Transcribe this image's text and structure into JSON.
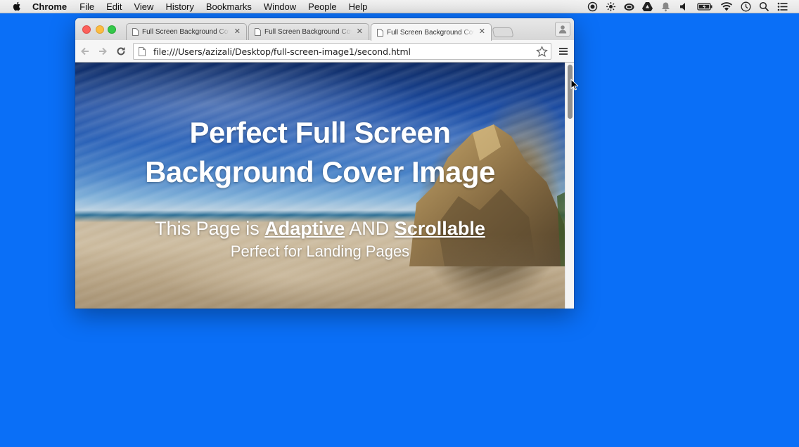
{
  "menubar": {
    "app_name": "Chrome",
    "items": [
      "File",
      "Edit",
      "View",
      "History",
      "Bookmarks",
      "Window",
      "People",
      "Help"
    ],
    "status_icons": [
      "record-icon",
      "brightness-icon",
      "creative-cloud-icon",
      "google-drive-icon",
      "notification-bell-icon",
      "volume-icon",
      "battery-icon",
      "wifi-icon",
      "clock-icon",
      "spotlight-search-icon",
      "notification-center-icon"
    ]
  },
  "browser": {
    "tabs": [
      {
        "title": "Full Screen Background Cover Image",
        "active": false
      },
      {
        "title": "Full Screen Background Cover Image",
        "active": false
      },
      {
        "title": "Full Screen Background Cover Image",
        "active": true
      }
    ],
    "url": "file:///Users/azizali/Desktop/full-screen-image1/second.html"
  },
  "page": {
    "title_line1": "Perfect Full Screen",
    "title_line2": "Background Cover Image",
    "subtitle_prefix": "This Page is ",
    "subtitle_link1": "Adaptive",
    "subtitle_mid": " AND ",
    "subtitle_link2": "Scrollable",
    "tagline": "Perfect for Landing Pages"
  },
  "colors": {
    "desktop": "#0a6ff7",
    "close": "#fc605b",
    "minimize": "#fdbc40",
    "maximize": "#34c84a"
  }
}
